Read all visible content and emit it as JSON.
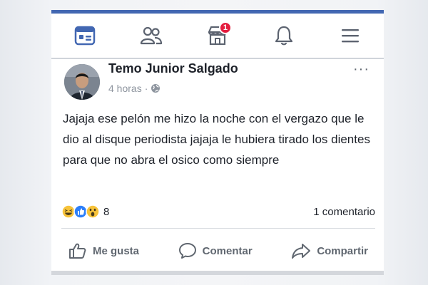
{
  "nav": {
    "items": [
      {
        "icon": "news-feed-icon",
        "active": true
      },
      {
        "icon": "friends-icon",
        "active": false
      },
      {
        "icon": "marketplace-icon",
        "active": false,
        "badge": "1"
      },
      {
        "icon": "bell-icon",
        "active": false
      },
      {
        "icon": "menu-icon",
        "active": false
      }
    ]
  },
  "post": {
    "author": "Temo Junior Salgado",
    "time": "4 horas",
    "separator": "·",
    "privacy_icon": "globe-icon",
    "more": "···",
    "text": "Jajaja ese pelón me hizo la noche con el vergazo que le dio al disque periodista jajaja le hubiera tirado los dientes para que no abra el osico como siempre",
    "reactions": {
      "icons": [
        "haha-icon",
        "like-icon",
        "wow-icon"
      ],
      "count": "8"
    },
    "comments_label": "1 comentario"
  },
  "actions": {
    "like": "Me gusta",
    "comment": "Comentar",
    "share": "Compartir"
  },
  "colors": {
    "brand": "#4267b2",
    "badge": "#e41e3f",
    "text": "#1d2129",
    "muted": "#606770"
  }
}
